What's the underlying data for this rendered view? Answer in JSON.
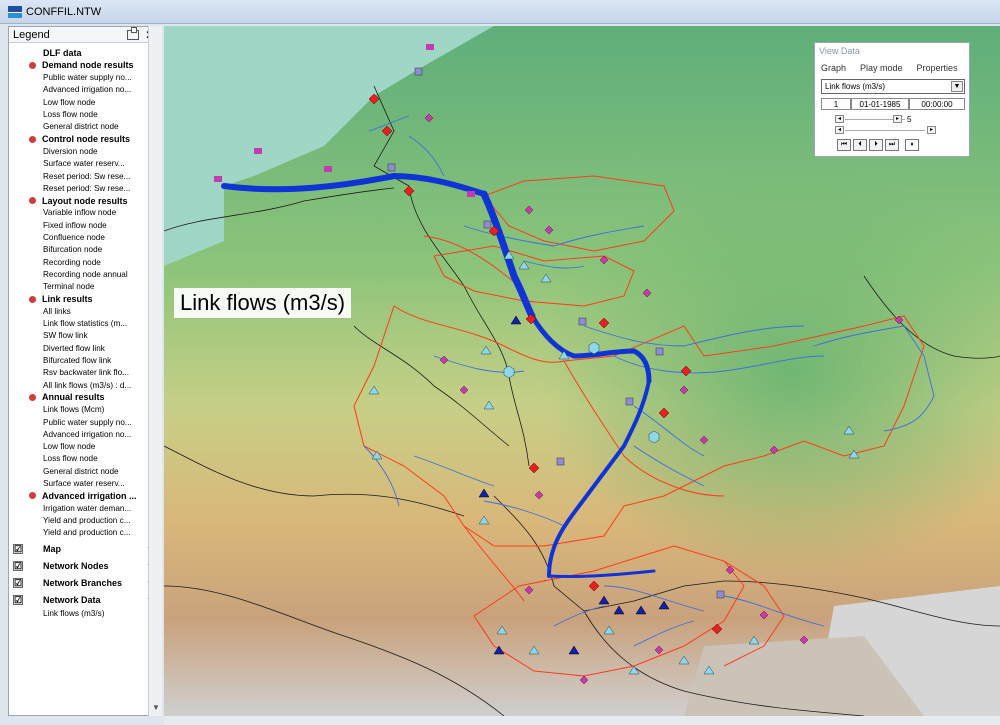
{
  "window": {
    "title": "CONFFIL.NTW"
  },
  "legend": {
    "title": "Legend",
    "items": [
      {
        "label": "DLF data",
        "type": "head"
      },
      {
        "label": "Demand node results",
        "type": "group"
      },
      {
        "label": "Public water supply no...",
        "type": "item"
      },
      {
        "label": "Advanced irrigation no...",
        "type": "item"
      },
      {
        "label": "Low flow node",
        "type": "item"
      },
      {
        "label": "Loss flow node",
        "type": "item"
      },
      {
        "label": "General district node",
        "type": "item"
      },
      {
        "label": "Control node results",
        "type": "group"
      },
      {
        "label": "Diversion node",
        "type": "item"
      },
      {
        "label": "Surface water reserv...",
        "type": "item"
      },
      {
        "label": "Reset period: Sw rese...",
        "type": "item"
      },
      {
        "label": "Reset period: Sw rese...",
        "type": "item"
      },
      {
        "label": "Layout node results",
        "type": "group"
      },
      {
        "label": "Variable inflow node",
        "type": "item"
      },
      {
        "label": "Fixed inflow node",
        "type": "item"
      },
      {
        "label": "Confluence node",
        "type": "item"
      },
      {
        "label": "Bifurcation node",
        "type": "item"
      },
      {
        "label": "Recording node",
        "type": "item"
      },
      {
        "label": "Recording node annual",
        "type": "item"
      },
      {
        "label": "Terminal node",
        "type": "item"
      },
      {
        "label": "Link results",
        "type": "group"
      },
      {
        "label": "All links",
        "type": "item"
      },
      {
        "label": "Link flow statistics (m...",
        "type": "item"
      },
      {
        "label": "SW flow link",
        "type": "item"
      },
      {
        "label": "Diverted flow link",
        "type": "item"
      },
      {
        "label": "Bifurcated flow link",
        "type": "item"
      },
      {
        "label": "Rsv backwater link flo...",
        "type": "item"
      },
      {
        "label": "All link flows (m3/s) : d...",
        "type": "item"
      },
      {
        "label": "Annual results",
        "type": "group"
      },
      {
        "label": "Link flows (Mcm)",
        "type": "item"
      },
      {
        "label": "Public water supply no...",
        "type": "item"
      },
      {
        "label": "Advanced irrigation no...",
        "type": "item"
      },
      {
        "label": "Low flow node",
        "type": "item"
      },
      {
        "label": "Loss flow node",
        "type": "item"
      },
      {
        "label": "General district node",
        "type": "item"
      },
      {
        "label": "Surface water reserv...",
        "type": "item"
      },
      {
        "label": "Advanced irrigation ...",
        "type": "group"
      },
      {
        "label": "Irrigation water deman...",
        "type": "item"
      },
      {
        "label": "Yield and production c...",
        "type": "item"
      },
      {
        "label": "Yield and production c...",
        "type": "item"
      }
    ],
    "layers": [
      {
        "label": "Map",
        "checked": "☑"
      },
      {
        "label": "Network Nodes",
        "checked": "☑"
      },
      {
        "label": "Network Branches",
        "checked": "☑"
      },
      {
        "label": "Network Data",
        "checked": "☑"
      }
    ],
    "layer_sub": "Link flows (m3/s)"
  },
  "map": {
    "overlay_label": "Link flows (m3/s)"
  },
  "view_data": {
    "title": "View Data",
    "menu": [
      "Graph",
      "Play mode",
      "Properties"
    ],
    "selected": "Link flows (m3/s)",
    "step": "1",
    "date": "01-01-1985",
    "time": "00:00:00",
    "speed": "5",
    "controls": [
      "⏮",
      "⏴",
      "⏵",
      "⏭"
    ],
    "pause": "⏸"
  },
  "colors": {
    "flow": "#1033d6",
    "river": "#3b6fe0",
    "basin_border": "#ff3a1a",
    "country_border": "#1a1a1a",
    "sea": "#9fd6c6"
  }
}
